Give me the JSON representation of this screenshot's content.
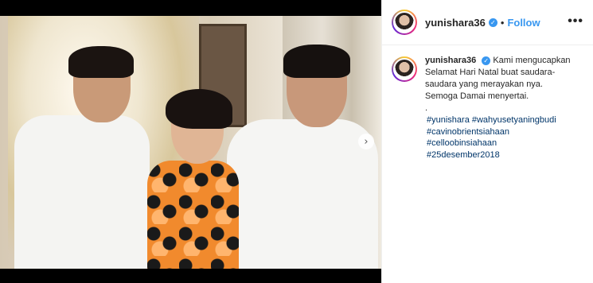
{
  "post": {
    "username": "yunishara36",
    "verified_mark": "✓",
    "dot": "•",
    "follow_label": "Follow",
    "more_label": "•••",
    "caption_text": "Kami mengucapkan Selamat Hari Natal buat saudara-saudara yang merayakan nya. Semoga Damai menyertai.",
    "period": ".",
    "hashtags": [
      "#yunishara #wahyusetyaningbudi",
      "#cavinobrientsiahaan",
      "#celloobinsiahaan",
      "#25desember2018"
    ],
    "next_icon": "›"
  },
  "icons": {
    "next": "chevron-right-icon",
    "verified": "verified-badge-icon",
    "more": "more-options-icon"
  },
  "colors": {
    "link_blue": "#3897f0",
    "hashtag_blue": "#003569",
    "text": "#262626"
  }
}
